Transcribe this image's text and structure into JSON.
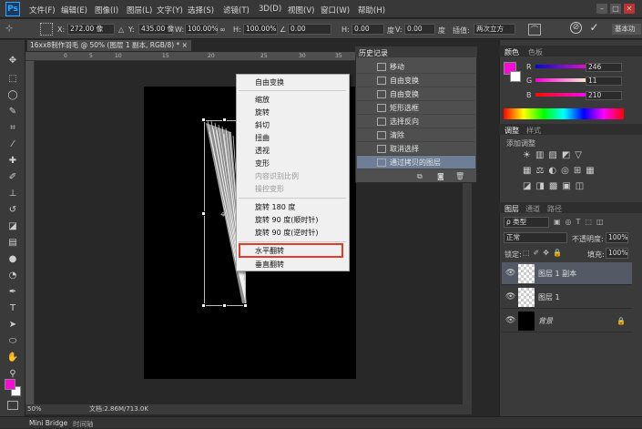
{
  "menubar": {
    "logo": "Ps",
    "items": [
      "文件(F)",
      "编辑(E)",
      "图像(I)",
      "图层(L)",
      "文字(Y)",
      "选择(S)",
      "滤镜(T)",
      "3D(D)",
      "视图(V)",
      "窗口(W)",
      "帮助(H)"
    ],
    "window_buttons": [
      "–",
      "□",
      "✕"
    ]
  },
  "options": {
    "x_label": "X:",
    "x_value": "272.00 像",
    "y_label": "Y:",
    "y_value": "435.00 像",
    "w_label": "W:",
    "w_value": "100.00%",
    "h_label": "H:",
    "h_value": "100.00%",
    "angle_value": "0.00",
    "h_skew_label": "H:",
    "h_skew_value": "0.00",
    "h_skew_unit": "度",
    "v_skew_label": "V:",
    "v_skew_value": "0.00",
    "v_skew_unit": "度",
    "interp_label": "插值:",
    "interp_value": "两次立方",
    "workspace": "基本功"
  },
  "document": {
    "tab_title": "16xx8制作羽毛 @ 50% (图层 1 副本, RGB/8) *",
    "tab_close": "×",
    "ruler_ticks": [
      "0",
      "5",
      "10",
      "15",
      "20",
      "25",
      "30",
      "35"
    ],
    "zoom": "50%",
    "doc_info": "文档:2.86M/713.0K"
  },
  "context_menu": {
    "items": [
      {
        "label": "自由变换",
        "disabled": false
      },
      {
        "label": "缩放",
        "disabled": false
      },
      {
        "label": "旋转",
        "disabled": false
      },
      {
        "label": "斜切",
        "disabled": false
      },
      {
        "label": "扭曲",
        "disabled": false
      },
      {
        "label": "透视",
        "disabled": false
      },
      {
        "label": "变形",
        "disabled": false
      },
      {
        "label": "内容识别比例",
        "disabled": true
      },
      {
        "label": "操控变形",
        "disabled": true
      },
      {
        "label": "旋转 180 度",
        "disabled": false
      },
      {
        "label": "旋转 90 度(顺时针)",
        "disabled": false
      },
      {
        "label": "旋转 90 度(逆时针)",
        "disabled": false
      },
      {
        "label": "水平翻转",
        "disabled": false
      },
      {
        "label": "垂直翻转",
        "disabled": false
      }
    ]
  },
  "history": {
    "title": "历史记录",
    "items": [
      "移动",
      "自由变换",
      "自由变换",
      "矩形选框",
      "选择反向",
      "清除",
      "取消选择",
      "通过拷贝的图层"
    ],
    "selected_index": 7
  },
  "color_panel": {
    "tabs": [
      "颜色",
      "色板"
    ],
    "r_label": "R",
    "r_value": "246",
    "g_label": "G",
    "g_value": "11",
    "b_label": "B",
    "b_value": "210",
    "foreground": "#f60bd2"
  },
  "adjust_panel": {
    "tabs": [
      "调整",
      "样式"
    ],
    "add_label": "添加调整"
  },
  "layers_panel": {
    "tabs": [
      "图层",
      "通道",
      "路径"
    ],
    "filter_label": "ρ 类型",
    "blend_mode": "正常",
    "opacity_label": "不透明度:",
    "opacity_value": "100%",
    "lock_label": "锁定:",
    "fill_label": "填充:",
    "fill_value": "100%",
    "layers": [
      {
        "name": "图层 1 副本",
        "selected": true
      },
      {
        "name": "图层 1",
        "selected": false
      },
      {
        "name": "背景",
        "selected": false
      }
    ]
  },
  "bottom_tabs": [
    "Mini Bridge",
    "时间轴"
  ]
}
